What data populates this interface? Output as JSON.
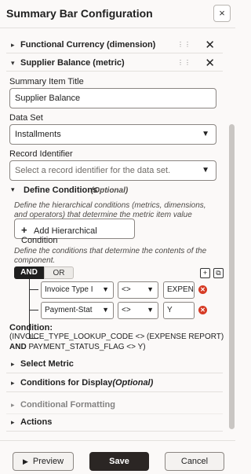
{
  "header": {
    "title": "Summary Bar Configuration",
    "close_icon": "×"
  },
  "items": [
    {
      "label": "Functional Currency (dimension)",
      "grip": "⠿",
      "remove": "✕"
    },
    {
      "label": "Supplier Balance (metric)",
      "grip": "⠿",
      "remove": "✕"
    }
  ],
  "form": {
    "summary_item_title_label": "Summary Item Title",
    "summary_item_title_value": "Supplier Balance",
    "data_set_label": "Data Set",
    "data_set_value": "Installments",
    "record_identifier_label": "Record Identifier",
    "record_identifier_placeholder": "Select a record identifier for the data set."
  },
  "conditions": {
    "section_label": "Define Conditions",
    "optional": "(Optional)",
    "help_hierarchical": "Define the hierarchical conditions (metrics, dimensions, and operators) that determine the metric item value",
    "add_button": "Add Hierarchical Condition",
    "add_icon": "+",
    "help_component": "Define the conditions that determine the contents of the component.",
    "toggle_and": "AND",
    "toggle_or": "OR",
    "rows": [
      {
        "field": "Invoice Type I",
        "operator": "<>",
        "value": "EXPEN"
      },
      {
        "field": "Payment-Stat",
        "operator": "<>",
        "value": "Y"
      }
    ],
    "condition_title": "Condition:",
    "condition_line1": "(INVOICE_TYPE_LOOKUP_CODE <> (EXPENSE REPORT)",
    "condition_line2_bold": "AND",
    "condition_line2": " PAYMENT_STATUS_FLAG <> Y)"
  },
  "sections": [
    {
      "label": "Select Metric",
      "optional": ""
    },
    {
      "label": "Conditions for Display",
      "optional": "(Optional)"
    },
    {
      "label": "Conditional Formatting",
      "optional": ""
    },
    {
      "label": "Actions",
      "optional": ""
    }
  ],
  "footer": {
    "preview": "Preview",
    "save": "Save",
    "cancel": "Cancel"
  },
  "icons": {
    "chevron_right": "›",
    "chevron_down": "⌄",
    "caret_down": "▼",
    "play": "▶"
  }
}
